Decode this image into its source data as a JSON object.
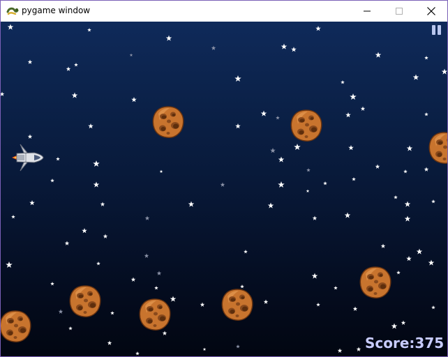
{
  "window": {
    "title": "pygame window",
    "controls": [
      "minimize-icon",
      "maximize-icon",
      "close-icon"
    ]
  },
  "game": {
    "score_label": "Score:375",
    "pause_icon": "pause-icon",
    "player_icon": "spaceship-icon",
    "enemy_icon": "asteroid-icon",
    "colors": {
      "sky_top": "#0f2a5a",
      "sky_bottom": "#020611",
      "score_text": "#c8ccff",
      "asteroid": "#c8742e"
    }
  }
}
